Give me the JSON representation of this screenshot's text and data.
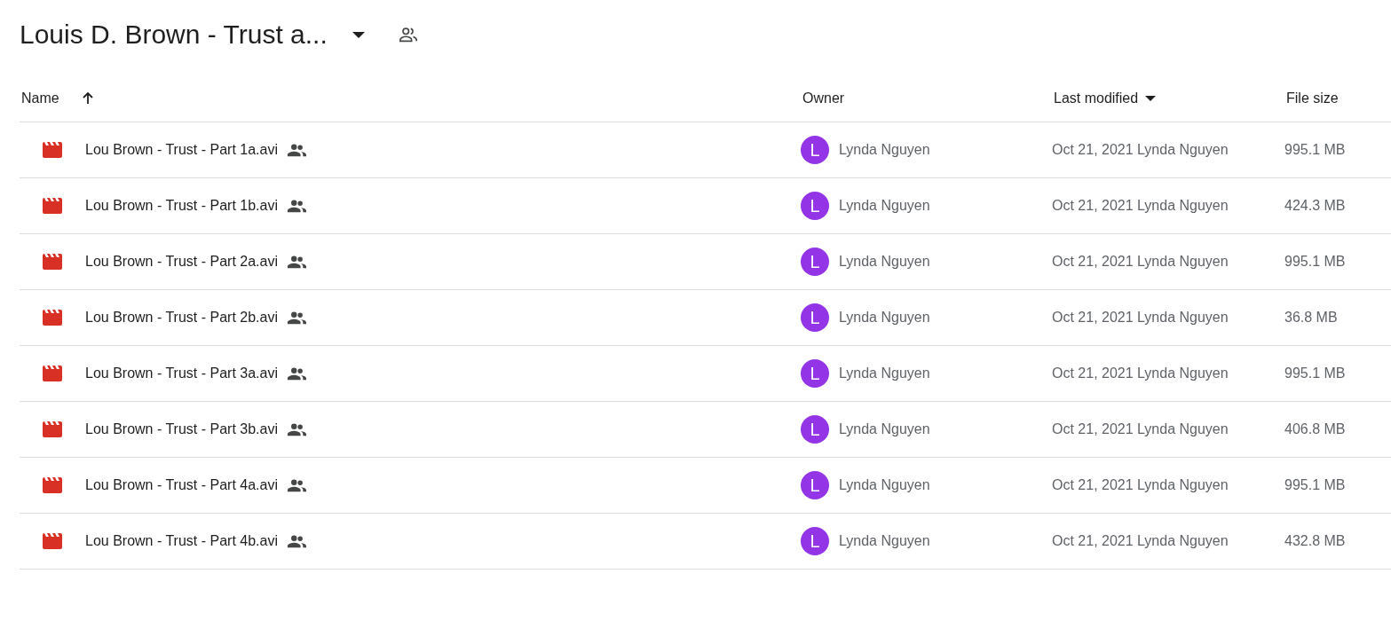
{
  "header": {
    "title": "Louis D. Brown - Trust a...",
    "shared": true
  },
  "table": {
    "columns": [
      {
        "label": "Name",
        "kind": "sorted"
      },
      {
        "label": "Owner"
      },
      {
        "label": "Last modified",
        "kind": "menu"
      },
      {
        "label": "File size"
      }
    ],
    "rows": [
      {
        "name": "Lou Brown - Trust - Part 1a.avi",
        "shared": true,
        "owner_initial": "L",
        "owner": "Lynda Nguyen",
        "modified": "Oct 21, 2021 Lynda Nguyen",
        "size": "995.1 MB"
      },
      {
        "name": "Lou Brown - Trust - Part 1b.avi",
        "shared": true,
        "owner_initial": "L",
        "owner": "Lynda Nguyen",
        "modified": "Oct 21, 2021 Lynda Nguyen",
        "size": "424.3 MB"
      },
      {
        "name": "Lou Brown - Trust - Part 2a.avi",
        "shared": true,
        "owner_initial": "L",
        "owner": "Lynda Nguyen",
        "modified": "Oct 21, 2021 Lynda Nguyen",
        "size": "995.1 MB"
      },
      {
        "name": "Lou Brown - Trust - Part 2b.avi",
        "shared": true,
        "owner_initial": "L",
        "owner": "Lynda Nguyen",
        "modified": "Oct 21, 2021 Lynda Nguyen",
        "size": "36.8 MB"
      },
      {
        "name": "Lou Brown - Trust - Part 3a.avi",
        "shared": true,
        "owner_initial": "L",
        "owner": "Lynda Nguyen",
        "modified": "Oct 21, 2021 Lynda Nguyen",
        "size": "995.1 MB"
      },
      {
        "name": "Lou Brown - Trust - Part 3b.avi",
        "shared": true,
        "owner_initial": "L",
        "owner": "Lynda Nguyen",
        "modified": "Oct 21, 2021 Lynda Nguyen",
        "size": "406.8 MB"
      },
      {
        "name": "Lou Brown - Trust - Part 4a.avi",
        "shared": true,
        "owner_initial": "L",
        "owner": "Lynda Nguyen",
        "modified": "Oct 21, 2021 Lynda Nguyen",
        "size": "995.1 MB"
      },
      {
        "name": "Lou Brown - Trust - Part 4b.avi",
        "shared": true,
        "owner_initial": "L",
        "owner": "Lynda Nguyen",
        "modified": "Oct 21, 2021 Lynda Nguyen",
        "size": "432.8 MB"
      }
    ]
  }
}
